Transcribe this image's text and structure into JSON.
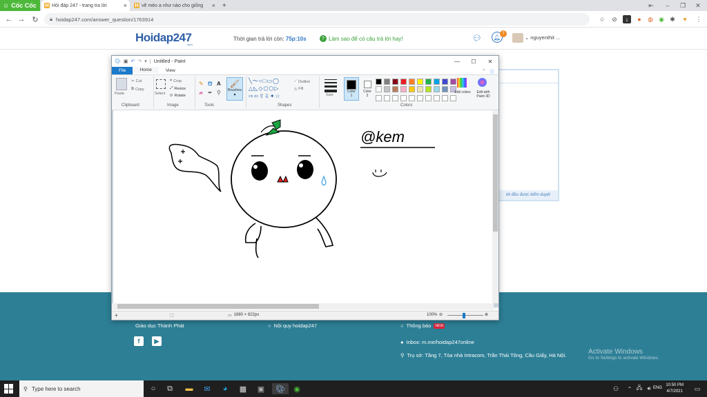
{
  "browser": {
    "brand": "Cốc Cốc",
    "tabs": [
      {
        "title": "Hỏi đáp 247 - trang tra lời",
        "active": true
      },
      {
        "title": "vẽ mèo a như nào cho giống",
        "active": false
      }
    ],
    "new_tab": "+",
    "url": "hoidap247.com/answer_question/1763914"
  },
  "site": {
    "logo": "Hoidap247",
    "logo_sub": ".com",
    "timer_label": "Thời gian trả lời còn:",
    "timer_value": "75p:10s",
    "howto_text": "Làm sao để có câu trả lời hay!",
    "notif_count": "7",
    "username": "nguyenthit ..."
  },
  "answer_note": "lời đều được kiểm duyệt",
  "paint": {
    "title": "Untitled - Paint",
    "tabs": [
      "File",
      "Home",
      "View"
    ],
    "clipboard": {
      "paste": "Paste",
      "cut": "Cut",
      "copy": "Copy",
      "label": "Clipboard"
    },
    "image": {
      "select": "Select",
      "crop": "Crop",
      "resize": "Resize",
      "rotate": "Rotate",
      "label": "Image"
    },
    "tools_label": "Tools",
    "brushes": "Brushes",
    "shapes": {
      "outline": "Outline",
      "fill": "Fill",
      "label": "Shapes"
    },
    "size": "Size",
    "color1": "Color 1",
    "color2": "Color 2",
    "colors_label": "Colors",
    "edit_colors": "Edit colors",
    "edit_paint3d": "Edit with Paint 3D",
    "palette": [
      "#000000",
      "#7f7f7f",
      "#880015",
      "#ed1c24",
      "#ff7f27",
      "#fff200",
      "#22b14c",
      "#00a2e8",
      "#3f48cc",
      "#a349a4",
      "#ffffff",
      "#c3c3c3",
      "#b97a57",
      "#ffaec9",
      "#ffc90e",
      "#efe4b0",
      "#b5e61d",
      "#99d9ea",
      "#7092be",
      "#c8bfe7"
    ],
    "canvas_size": "1880 × 822px",
    "zoom": "100%",
    "signature_text": "@kem"
  },
  "footer": {
    "company": "Giáo dục Thành Phát",
    "rules": "Nội quy hoidap247",
    "notify": "Thông báo",
    "new_badge": "NEW",
    "inbox": "Inbox: m.me/hoidap247online",
    "address": "Trụ sở: Tầng 7, Tòa nhà Intracom, Trần Thái Tông, Cầu Giấy, Hà Nội.",
    "activate_title": "Activate Windows",
    "activate_sub": "Go to Settings to activate Windows."
  },
  "taskbar": {
    "search_placeholder": "Type here to search",
    "lang": "ENG",
    "time": "10:50 PM",
    "date": "4/7/2021"
  }
}
